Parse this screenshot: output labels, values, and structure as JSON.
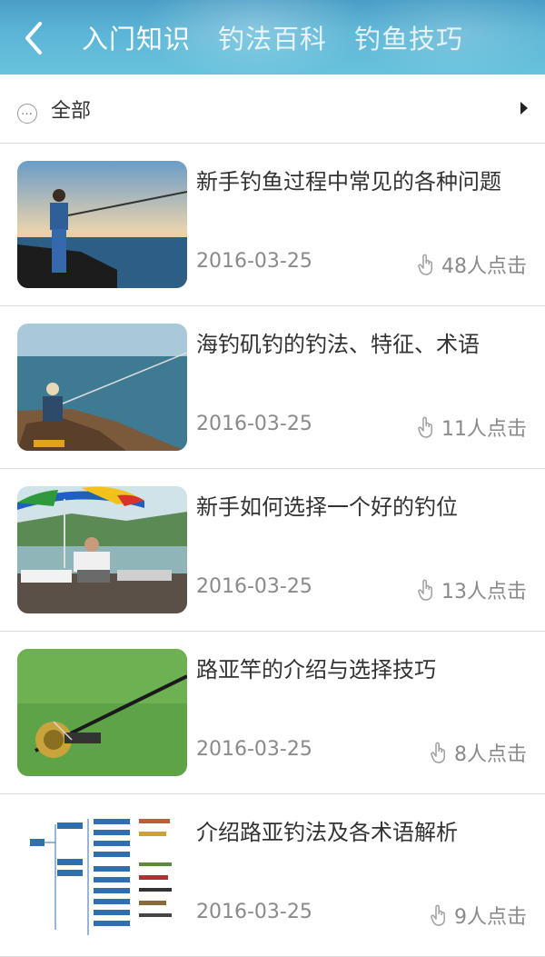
{
  "header": {
    "tabs": [
      {
        "label": "入门知识",
        "active": true
      },
      {
        "label": "钓法百科",
        "active": false
      },
      {
        "label": "钓鱼技巧",
        "active": false
      }
    ]
  },
  "filter": {
    "label": "全部"
  },
  "articles": [
    {
      "title": "新手钓鱼过程中常见的各种问题",
      "date": "2016-03-25",
      "clicks": "48人点击"
    },
    {
      "title": "海钓矶钓的钓法、特征、术语",
      "date": "2016-03-25",
      "clicks": "11人点击"
    },
    {
      "title": "新手如何选择一个好的钓位",
      "date": "2016-03-25",
      "clicks": "13人点击"
    },
    {
      "title": "路亚竿的介绍与选择技巧",
      "date": "2016-03-25",
      "clicks": "8人点击"
    },
    {
      "title": "介绍路亚钓法及各术语解析",
      "date": "2016-03-25",
      "clicks": "9人点击"
    }
  ],
  "colors": {
    "header": "#5cb5d6",
    "meta_text": "#8a8a8a",
    "divider": "#dcdcdc"
  },
  "icons": {
    "back": "chevron-left-icon",
    "more": "more-icon",
    "arrow": "caret-right-icon",
    "clicks": "tap-icon"
  }
}
